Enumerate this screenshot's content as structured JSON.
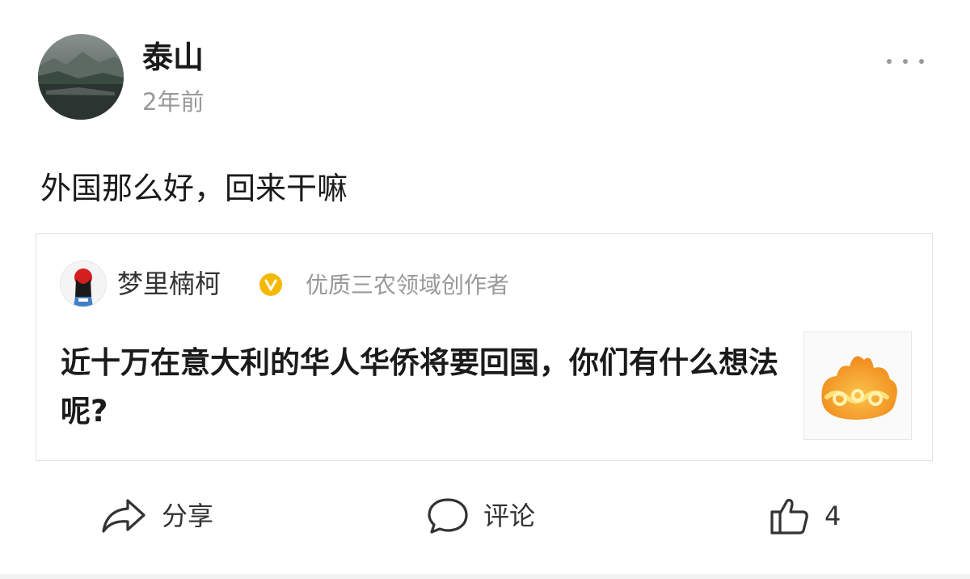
{
  "post": {
    "author_name": "泰山",
    "time": "2年前",
    "text": "外国那么好，回来干嘛"
  },
  "quote": {
    "author_name": "梦里楠柯",
    "verified_icon": "verified-v-badge-icon",
    "author_desc": "优质三农领域创作者",
    "title": "近十万在意大利的华人华侨将要回国，你们有什么想法呢?"
  },
  "actions": {
    "share_label": "分享",
    "comment_label": "评论",
    "like_count": "4"
  },
  "icons": {
    "more": "more-dots-icon",
    "share": "share-arrow-icon",
    "comment": "comment-bubble-icon",
    "like": "thumbs-up-icon"
  },
  "colors": {
    "verified": "#f5b800",
    "secondary_text": "#999999",
    "thumb_orange": "#f5a623"
  }
}
